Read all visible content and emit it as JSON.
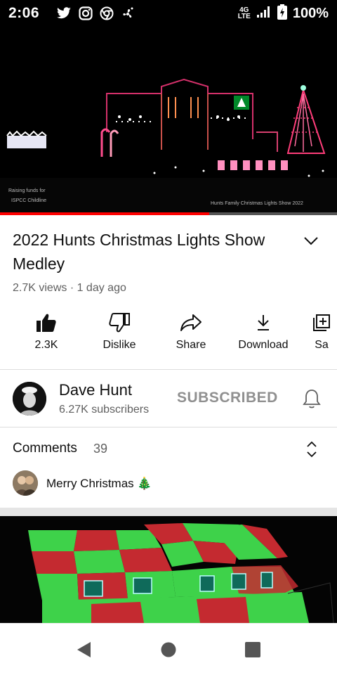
{
  "status_bar": {
    "time": "2:06",
    "network_top": "4G",
    "network_bottom": "LTE",
    "battery": "100%",
    "icons": [
      "twitter-icon",
      "instagram-icon",
      "chrome-icon",
      "fan-icon",
      "signal-icon",
      "battery-icon"
    ]
  },
  "player": {
    "caption_left_line1": "Raising funds for",
    "caption_left_line2": "ISPCC Childline",
    "caption_right": "Hunts Family Christmas Lights Show 2022",
    "progress": 0.62
  },
  "video": {
    "title": "2022 Hunts Christmas Lights Show Medley",
    "meta": "2.7K views · 1 day ago"
  },
  "actions": {
    "like": "2.3K",
    "dislike": "Dislike",
    "share": "Share",
    "download": "Download",
    "save": "Sa"
  },
  "channel": {
    "name": "Dave Hunt",
    "subscribers": "6.27K subscribers",
    "subscribe_state": "SUBSCRIBED"
  },
  "comments": {
    "label": "Comments",
    "count": "39",
    "top_comment": "Merry Christmas 🎄"
  },
  "colors": {
    "progress_red": "#ff0000",
    "text_primary": "#0f0f0f",
    "text_secondary": "#606060",
    "subscribed_gray": "#909090"
  }
}
